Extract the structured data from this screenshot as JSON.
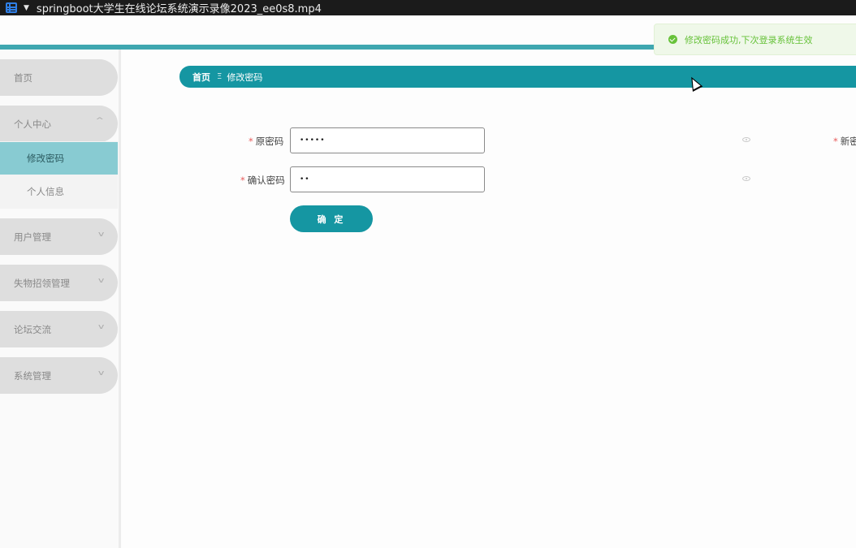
{
  "player": {
    "title": "springboot大学生在线论坛系统演示录像2023_ee0s8.mp4"
  },
  "sidebar": {
    "home": "首页",
    "personal_center": "个人中心",
    "personal_submenu": [
      "修改密码",
      "个人信息"
    ],
    "menus": [
      "用户管理",
      "失物招领管理",
      "论坛交流",
      "系统管理"
    ]
  },
  "breadcrumb": {
    "home": "首页",
    "separator": "Ξ",
    "current": "修改密码"
  },
  "form": {
    "required_mark": "*",
    "old_password_label": "原密码",
    "old_password_value": "•••••",
    "new_password_label": "新密码",
    "confirm_password_label": "确认密码",
    "confirm_password_value": "••",
    "submit_label": "确 定"
  },
  "toast": {
    "message": "修改密码成功,下次登录系统生效",
    "type": "success"
  },
  "theme": {
    "primary": "#1596a2",
    "active_menu": "#88cbd2",
    "success": "#67c23a",
    "required": "#e85a5a"
  },
  "icons": {
    "expand": "chevron-down-icon",
    "collapse": "chevron-up-icon",
    "password_toggle": "eye-icon",
    "toast": "check-circle-icon"
  }
}
